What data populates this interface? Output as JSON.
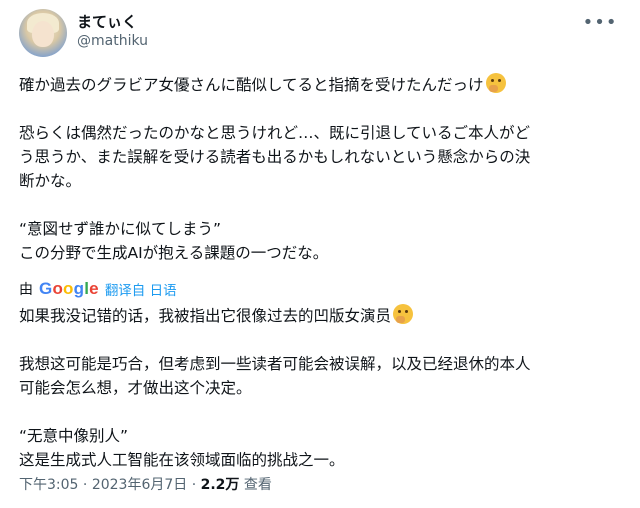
{
  "author": {
    "name": "まてぃく",
    "handle": "@mathiku"
  },
  "tweet": {
    "original": {
      "line1": "確か過去のグラビア女優さんに酷似してると指摘を受けたんだっけ",
      "line2a": "恐らくは偶然だったのかなと思うけれど…、既に引退しているご本人がど",
      "line2b": "う思うか、また誤解を受ける読者も出るかもしれないという懸念からの決",
      "line2c": "断かな。",
      "line3a": "“意図せず誰かに似てしまう”",
      "line3b": "この分野で生成AIが抱える課題の一つだな。"
    },
    "translation": {
      "by_label": "由",
      "provider": "Google",
      "link_text": "翻译自 日语",
      "line1": "如果我没记错的话，我被指出它很像过去的凹版女演员",
      "line2a": "我想这可能是巧合，但考虑到一些读者可能会被误解，以及已经退休的本人",
      "line2b": "可能会怎么想，才做出这个决定。",
      "line3a": "“无意中像别人”",
      "line3b": "这是生成式人工智能在该领域面临的挑战之一。"
    }
  },
  "meta": {
    "time": "下午3:05",
    "sep1": " · ",
    "date": "2023年6月7日",
    "sep2": " · ",
    "views_count": "2.2万",
    "views_label": " 查看"
  },
  "icons": {
    "more": "more-icon",
    "emoji": "thinking-face-emoji"
  }
}
